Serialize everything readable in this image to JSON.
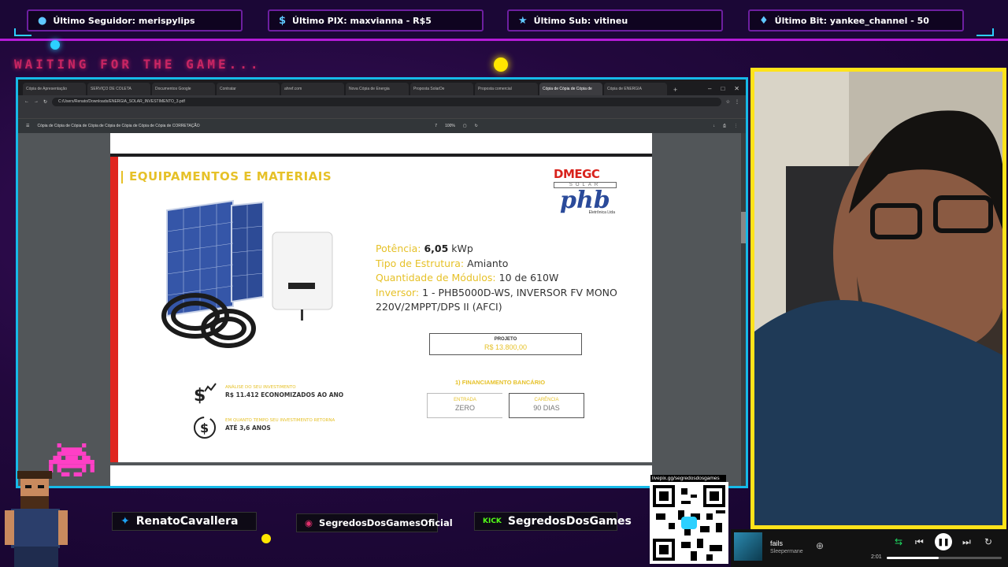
{
  "alerts": [
    {
      "icon": "user-icon",
      "text": "Último Seguidor: merispylips"
    },
    {
      "icon": "dollar-icon",
      "text": "Último PIX: maxvianna - R$5"
    },
    {
      "icon": "star-icon",
      "text": "Último Sub: vitineu"
    },
    {
      "icon": "diamond-icon",
      "text": "Último Bit: yankee_channel - 50"
    }
  ],
  "overlay": {
    "waiting_text": "WAITING FOR THE GAME..."
  },
  "browser": {
    "tabs": [
      "Cópia de Apresentação",
      "SERVIÇO DE COLETA",
      "Documentos Google",
      "Contratar",
      "IA",
      "ahref.com",
      "Nova Cópia de Energia",
      "Proposta SolarDe",
      "Proposta comercial",
      "Cópia de Cópia de Cópia de",
      "Cópia de ENERGIA"
    ],
    "active_tab": 9,
    "address": "C:/Users/Renato/Downloads/ENERGIA_SOLAR_INVESTIMENTO_3.pdf",
    "pdf_title": "Cópia de Cópia de Cópia de Cópia de Cópia de Cópia de Cópia de Cópia de CORRETAÇÃO",
    "page": "7",
    "zoom": "100%"
  },
  "slide": {
    "title": "EQUIPAMENTOS E MATERIAIS",
    "brand1_main": "DMEGC",
    "brand1_sub": "SOLAR",
    "brand2_main": "phb",
    "brand2_sub": "Eletrônica Ltda",
    "specs": [
      {
        "label": "Potência:",
        "value": "6,05",
        "unit": " kWp"
      },
      {
        "label": "Tipo de Estrutura:",
        "value": "",
        "unit": " Amianto"
      },
      {
        "label": "Quantidade de Módulos:",
        "value": "",
        "unit": " 10 de 610W"
      },
      {
        "label": "Inversor:",
        "value": "",
        "unit": " 1 - PHB5000D-WS, INVERSOR FV MONO 220V/2MPPT/DPS II (AFCI)"
      }
    ],
    "projeto_label": "PROJETO",
    "projeto_value": "R$ 13.800,00",
    "financ_title": "1) FINANCIAMENTO BANCÁRIO",
    "entrada_label": "ENTRADA",
    "entrada_value": "ZERO",
    "carencia_label": "CARÊNCIA",
    "carencia_value": "90 DIAS",
    "invest1_label": "ANÁLISE DO SEU INVESTIMENTO",
    "invest1_value": "R$ 11.412 ECONOMIZADOS AO ANO",
    "invest2_label": "EM QUANTO TEMPO SEU INVESTIMENTO RETORNA",
    "invest2_value": "ATÉ 3,6 ANOS"
  },
  "socials": [
    {
      "icon": "twitter-icon",
      "handle": "RenatoCavallera",
      "color": "#1da1f2"
    },
    {
      "icon": "instagram-icon",
      "handle": "SegredosDosGamesOficial",
      "color": "#e1306c"
    },
    {
      "icon": "kick-icon",
      "handle": "SegredosDosGames",
      "color": "#53fc18"
    }
  ],
  "qr": {
    "label": "livepix.gg/segredosdosgames"
  },
  "music": {
    "song": "fails",
    "artist": "Sleepermane",
    "time": "2:01",
    "progress": 0.45
  }
}
